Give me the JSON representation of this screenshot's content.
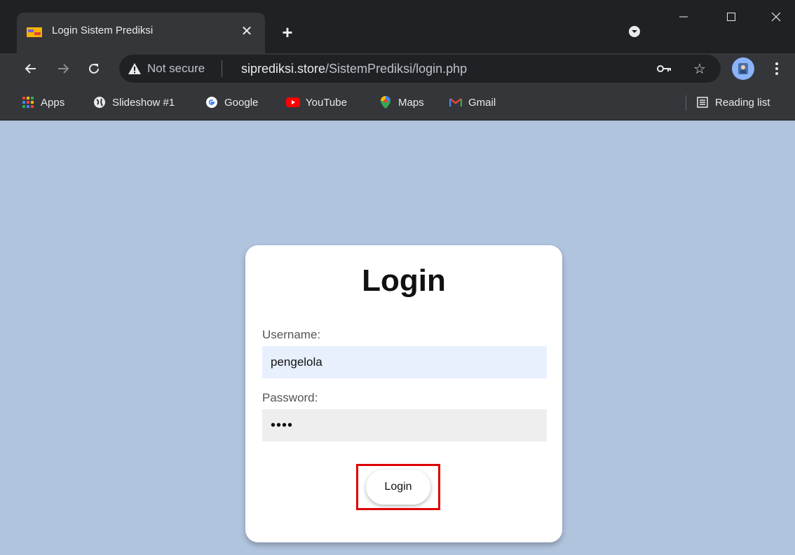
{
  "browser": {
    "tab_title": "Login Sistem Prediksi",
    "omnibox": {
      "security_text": "Not secure",
      "url_host": "siprediksi.store",
      "url_path": "/SistemPrediksi/login.php"
    },
    "bookmarks": [
      {
        "label": "Apps",
        "icon": "apps-grid-icon"
      },
      {
        "label": "Slideshow #1",
        "icon": "globe-icon"
      },
      {
        "label": "Google",
        "icon": "google-icon"
      },
      {
        "label": "YouTube",
        "icon": "youtube-icon"
      },
      {
        "label": "Maps",
        "icon": "maps-pin-icon"
      },
      {
        "label": "Gmail",
        "icon": "gmail-icon"
      }
    ],
    "reading_list": "Reading list"
  },
  "login": {
    "title": "Login",
    "username_label": "Username:",
    "username_value": "pengelola",
    "password_label": "Password:",
    "password_value": "••••",
    "button_label": "Login"
  },
  "colors": {
    "page_background": "#b0c4de",
    "highlight_border": "#e00000",
    "autofill_background": "#e8f0fe"
  }
}
